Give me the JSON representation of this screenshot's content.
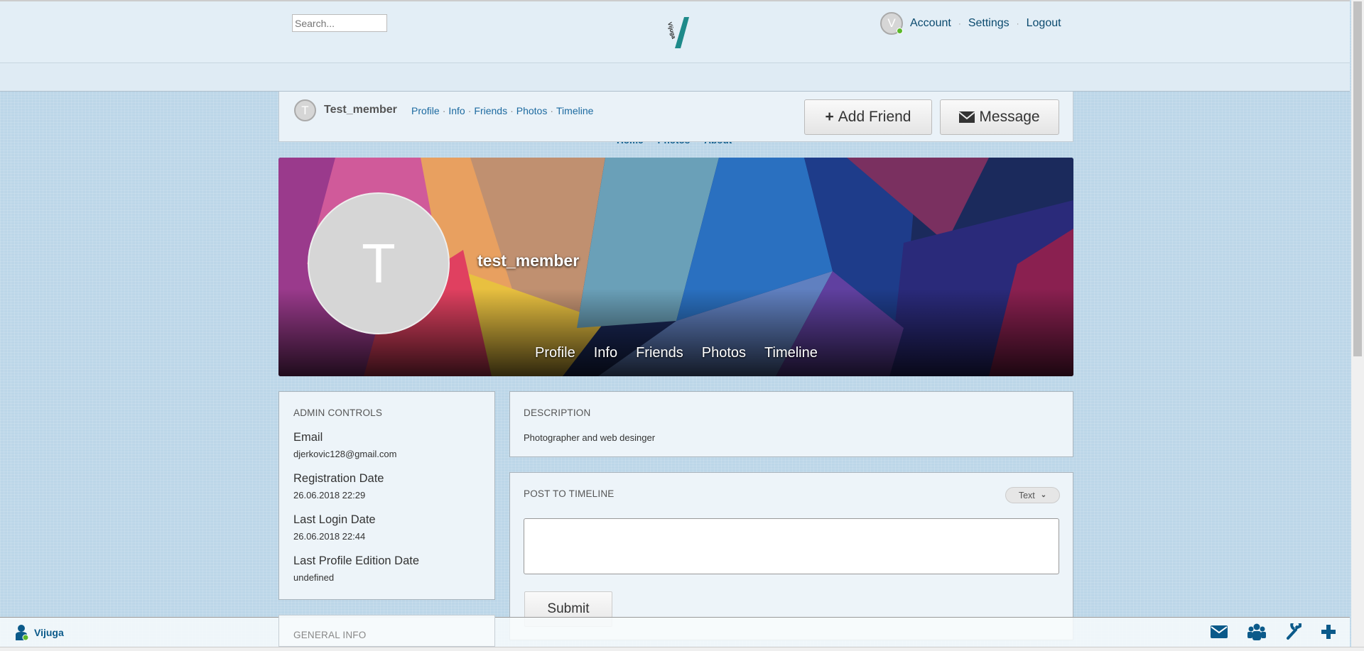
{
  "header": {
    "search_placeholder": "Search...",
    "logo_text": "Vijuga",
    "avatar_letter": "V",
    "account": "Account",
    "settings": "Settings",
    "logout": "Logout"
  },
  "nav": {
    "items": [
      "Home",
      "Photos",
      "About"
    ]
  },
  "profile_bar": {
    "avatar_letter": "T",
    "username": "Test_member",
    "links": [
      "Profile",
      "Info",
      "Friends",
      "Photos",
      "Timeline"
    ],
    "add_friend": "Add Friend",
    "message": "Message"
  },
  "cover": {
    "avatar_letter": "T",
    "name": "test_member",
    "links": [
      "Profile",
      "Info",
      "Friends",
      "Photos",
      "Timeline"
    ]
  },
  "admin": {
    "title": "ADMIN CONTROLS",
    "fields": [
      {
        "label": "Email",
        "value": "djerkovic128@gmail.com"
      },
      {
        "label": "Registration Date",
        "value": "26.06.2018 22:29"
      },
      {
        "label": "Last Login Date",
        "value": "26.06.2018 22:44"
      },
      {
        "label": "Last Profile Edition Date",
        "value": "undefined"
      }
    ]
  },
  "general": {
    "title": "GENERAL INFO"
  },
  "description": {
    "title": "DESCRIPTION",
    "text": "Photographer and web desinger"
  },
  "post": {
    "title": "POST TO TIMELINE",
    "type": "Text",
    "textarea_value": "",
    "submit": "Submit"
  },
  "footer": {
    "brand": "Vijuga",
    "icons": [
      "envelope-icon",
      "users-icon",
      "wrench-icon",
      "plus-icon"
    ]
  },
  "colors": {
    "accent": "#0b5a8a",
    "logo": "#1e8a8a"
  }
}
